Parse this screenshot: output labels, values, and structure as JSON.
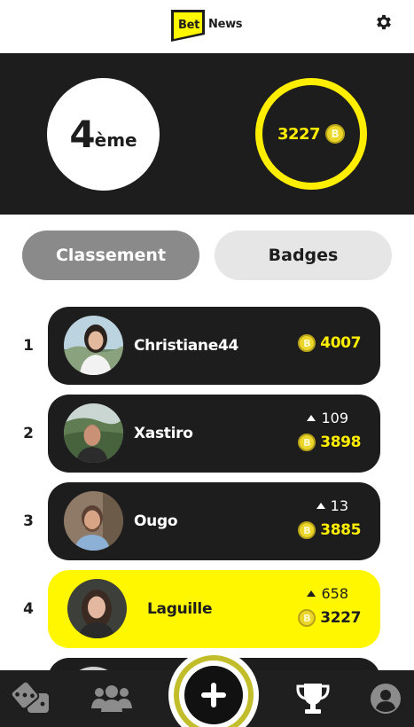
{
  "header": {
    "logo_bet": "Bet",
    "logo_news": "News",
    "icons": {
      "settings": "gear-icon"
    }
  },
  "summary": {
    "rank_number": "4",
    "rank_suffix": "ème",
    "coins": "3227",
    "coin_symbol": "B"
  },
  "tabs": [
    {
      "label": "Classement",
      "active": true
    },
    {
      "label": "Badges",
      "active": false
    }
  ],
  "leaderboard": [
    {
      "rank": "1",
      "username": "Christiane44",
      "delta": "",
      "points": "4007",
      "coin_symbol": "B"
    },
    {
      "rank": "2",
      "username": "Xastiro",
      "delta": "109",
      "points": "3898",
      "coin_symbol": "B"
    },
    {
      "rank": "3",
      "username": "Ougo",
      "delta": "13",
      "points": "3885",
      "coin_symbol": "B"
    },
    {
      "rank": "4",
      "username": "Laguille",
      "delta": "658",
      "points": "3227",
      "coin_symbol": "B",
      "is_current_user": true
    }
  ],
  "bottom_nav": [
    {
      "icon": "dice-icon"
    },
    {
      "icon": "users-icon"
    },
    {
      "icon": "plus-icon"
    },
    {
      "icon": "trophy-icon",
      "active": true
    },
    {
      "icon": "profile-icon"
    }
  ],
  "colors": {
    "accent_yellow": "#fff700",
    "dark": "#1d1d1d",
    "tab_active": "#8a8a8a",
    "tab_inactive": "#e6e6e6"
  }
}
